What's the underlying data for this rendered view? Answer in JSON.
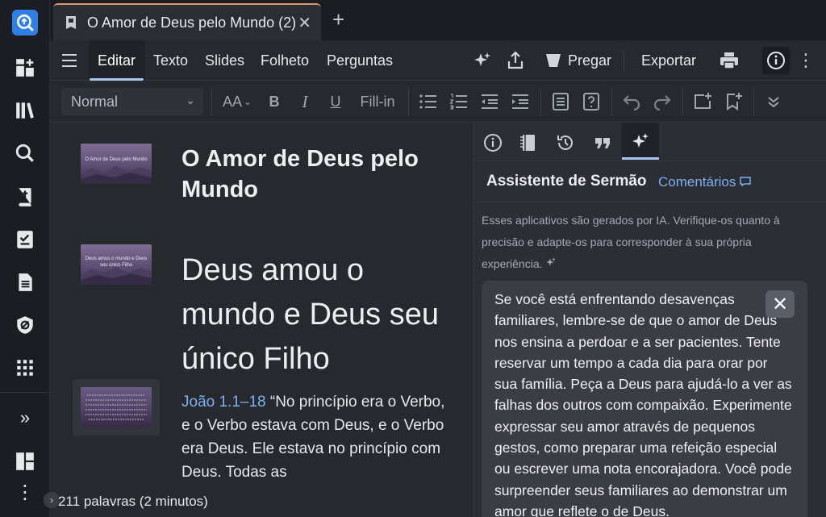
{
  "tab": {
    "title": "O Amor de Deus pelo Mundo (2)",
    "close": "✕",
    "new_tab": "+"
  },
  "rail": {
    "icons": [
      "search-app-icon",
      "dashboard-add-icon",
      "library-icon",
      "search-icon",
      "bible-icon",
      "checklist-icon",
      "document-icon",
      "shield-icon",
      "apps-grid-icon",
      "expand-icon",
      "layout-icon",
      "more-icon"
    ],
    "expand_glyph": "»",
    "more_glyph": "⋮"
  },
  "toolbar": {
    "menu_icon": "hamburger-icon",
    "tabs": [
      "Editar",
      "Texto",
      "Slides",
      "Folheto",
      "Perguntas"
    ],
    "active_tab": "Editar",
    "preach_label": "Pregar",
    "export_label": "Exportar"
  },
  "format": {
    "style_value": "Normal",
    "fill_in_label": "Fill-in",
    "bold": "B",
    "italic": "I",
    "underline": "U",
    "font_size": "AA"
  },
  "editor": {
    "slides": [
      {
        "thumb_text": "O Amor de Deus pelo Mundo"
      },
      {
        "thumb_text": "Deus amou o mundo e Deus seu único Filho"
      },
      {
        "thumb_text": ""
      }
    ],
    "heading": "O Amor de Deus pelo Mundo",
    "big_text": "Deus amou o mundo e Deus seu único Filho",
    "verse_ref": "João 1.1–18",
    "verse_text": " “No princípio era o Verbo, e o Verbo estava com Deus, e o Verbo era Deus. Ele estava no princípio com Deus. Todas as",
    "word_count": "211 palavras (2 minutos)"
  },
  "sidepanel": {
    "title": "Assistente de Sermão",
    "comments_link": "Comentários",
    "disclaimer": "Esses aplicativos são gerados por IA. Verifique-os quanto à precisão e adapte-os para corresponder à sua própria experiência.",
    "card_text": "Se você está enfrentando desavenças familiares, lembre-se de que o amor de Deus nos ensina a perdoar e a ser pacientes. Tente reservar um tempo a cada dia para orar por sua família. Peça a Deus para ajudá-lo a ver as falhas dos outros com compaixão. Experimente expressar seu amor através de pequenos gestos, como preparar uma refeição especial ou escrever uma nota encorajadora. Você pode surpreender seus familiares ao demonstrar um amor que reflete o de Deus.",
    "card_close": "✕"
  },
  "colors": {
    "accent": "#a8c5ee",
    "link": "#7db1f0",
    "tab_top": "#d49a6a",
    "app_icon": "#3d8ef0"
  }
}
